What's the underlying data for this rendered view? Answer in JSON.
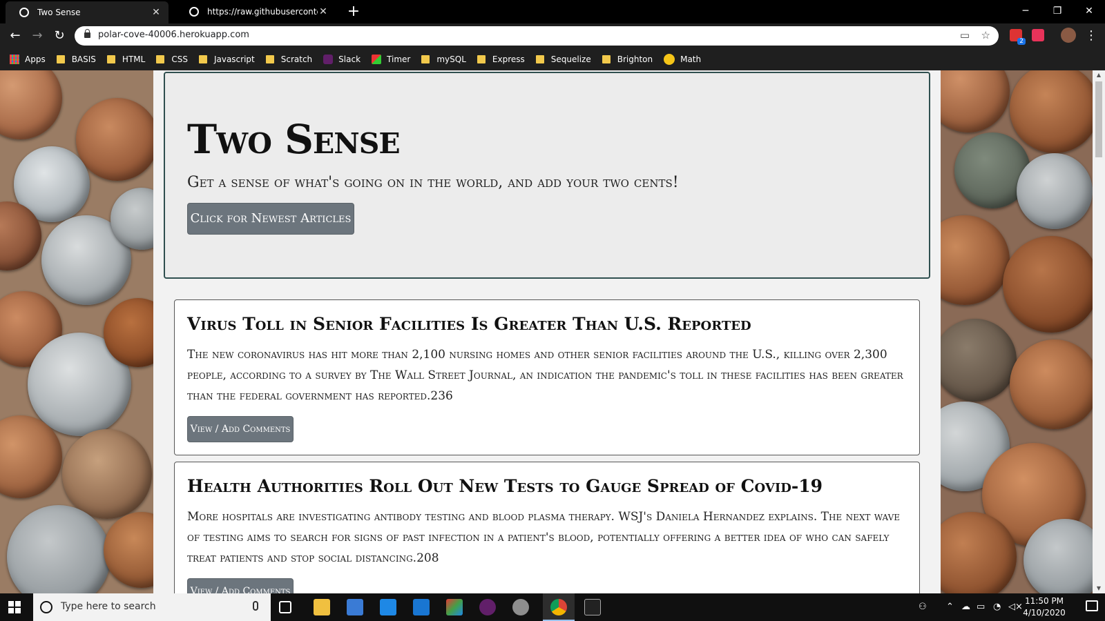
{
  "browser": {
    "tabs": [
      {
        "title": "Two Sense",
        "active": true
      },
      {
        "title": "https://raw.githubusercontent.co",
        "active": false
      }
    ],
    "new_tab": "+",
    "window_controls": {
      "minimize": "─",
      "maximize": "❐",
      "close": "✕"
    },
    "nav": {
      "back": "←",
      "forward": "→",
      "reload": "↻"
    },
    "url": "polar-cove-40006.herokuapp.com",
    "menu": "⋮",
    "extension_badge": "2",
    "bookmarks": [
      {
        "label": "Apps",
        "icon": "apps-grid-icon"
      },
      {
        "label": "BASIS",
        "icon": "folder-icon"
      },
      {
        "label": "HTML",
        "icon": "folder-icon"
      },
      {
        "label": "CSS",
        "icon": "folder-icon"
      },
      {
        "label": "Javascript",
        "icon": "folder-icon"
      },
      {
        "label": "Scratch",
        "icon": "folder-icon"
      },
      {
        "label": "Slack",
        "icon": "slack-icon"
      },
      {
        "label": "Timer",
        "icon": "timer-icon"
      },
      {
        "label": "mySQL",
        "icon": "folder-icon"
      },
      {
        "label": "Express",
        "icon": "folder-icon"
      },
      {
        "label": "Sequelize",
        "icon": "folder-icon"
      },
      {
        "label": "Brighton",
        "icon": "folder-icon"
      },
      {
        "label": "Math",
        "icon": "math-icon"
      }
    ]
  },
  "page": {
    "jumbotron": {
      "title": "Two Sense",
      "subtitle": "Get a sense of what's going on in the world, and add your two cents!",
      "button": "Click for Newest Articles"
    },
    "articles": [
      {
        "title": "Virus Toll in Senior Facilities Is Greater Than U.S. Reported",
        "summary": "The new coronavirus has hit more than 2,100 nursing homes and other senior facilities around the U.S., killing over 2,300 people, according to a survey by The Wall Street Journal, an indication the pandemic's toll in these facilities has been greater than the federal government has reported.236",
        "button": "View / Add Comments"
      },
      {
        "title": "Health Authorities Roll Out New Tests to Gauge Spread of Covid-19",
        "summary": "More hospitals are investigating antibody testing and blood plasma therapy. WSJ's Daniela Hernandez explains. The next wave of testing aims to search for signs of past infection in a patient's blood, potentially offering a better idea of who can safely treat patients and stop social distancing.208",
        "button": "View / Add Comments"
      }
    ],
    "colors": {
      "button": "#6c757d",
      "jumbotron_border": "#2f4f4f",
      "page_bg": "#f2f2f2"
    }
  },
  "taskbar": {
    "search_placeholder": "Type here to search",
    "time": "11:50 PM",
    "date": "4/10/2020"
  }
}
